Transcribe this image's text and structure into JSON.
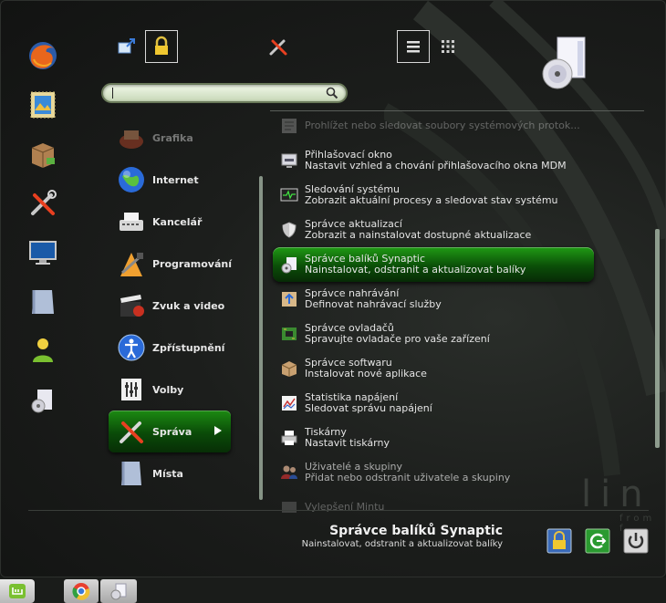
{
  "categories": [
    {
      "label": "Grafika",
      "icon": "graphics-icon",
      "state": "faded"
    },
    {
      "label": "Internet",
      "icon": "globe-icon",
      "state": "normal"
    },
    {
      "label": "Kancelář",
      "icon": "typewriter-icon",
      "state": "normal"
    },
    {
      "label": "Programování",
      "icon": "programming-icon",
      "state": "normal"
    },
    {
      "label": "Zvuk a video",
      "icon": "clapperboard-icon",
      "state": "normal"
    },
    {
      "label": "Zpřístupnění",
      "icon": "accessibility-icon",
      "state": "normal"
    },
    {
      "label": "Volby",
      "icon": "preferences-icon",
      "state": "normal"
    },
    {
      "label": "Správa",
      "icon": "tools-icon",
      "state": "selected"
    },
    {
      "label": "Místa",
      "icon": "folder-icon",
      "state": "normal"
    }
  ],
  "apps": [
    {
      "name": "Prohlížet nebo sledovat soubory systémových protok...",
      "desc": "",
      "icon": "log-viewer-icon",
      "state": "faded"
    },
    {
      "name": "Přihlašovací okno",
      "desc": "Nastavit vzhled a chování přihlašovacího okna MDM",
      "icon": "login-window-icon",
      "state": "normal"
    },
    {
      "name": "Sledování systému",
      "desc": "Zobrazit aktuální procesy a sledovat stav systému",
      "icon": "system-monitor-icon",
      "state": "normal"
    },
    {
      "name": "Správce aktualizací",
      "desc": "Zobrazit a nainstalovat dostupné aktualizace",
      "icon": "shield-icon",
      "state": "normal"
    },
    {
      "name": "Správce balíků Synaptic",
      "desc": "Nainstalovat, odstranit a aktualizovat balíky",
      "icon": "synaptic-icon",
      "state": "selected"
    },
    {
      "name": "Správce nahrávání",
      "desc": "Definovat nahrávací služby",
      "icon": "upload-manager-icon",
      "state": "normal"
    },
    {
      "name": "Správce ovladačů",
      "desc": "Spravujte ovladače pro vaše zařízení",
      "icon": "driver-chip-icon",
      "state": "normal"
    },
    {
      "name": "Správce softwaru",
      "desc": "Instalovat nové aplikace",
      "icon": "software-box-icon",
      "state": "normal"
    },
    {
      "name": "Statistika napájení",
      "desc": "Sledovat správu napájení",
      "icon": "power-stats-icon",
      "state": "normal"
    },
    {
      "name": "Tiskárny",
      "desc": "Nastavit tiskárny",
      "icon": "printer-icon",
      "state": "normal"
    },
    {
      "name": "Uživatelé a skupiny",
      "desc": "Přidat nebo odstranit uživatele a skupiny",
      "icon": "users-icon",
      "state": "half"
    },
    {
      "name": "Vylepšení Mintu",
      "desc": "",
      "icon": "mint-tweaks-icon",
      "state": "faded"
    }
  ],
  "selected_app": {
    "name": "Správce balíků Synaptic",
    "desc": "Nainstalovat, odstranit a aktualizovat balíky"
  },
  "watermark": {
    "main": "lin",
    "sub": "from f"
  },
  "colors": {
    "accent": "#1c8a12",
    "background": "#1c1e1c"
  }
}
